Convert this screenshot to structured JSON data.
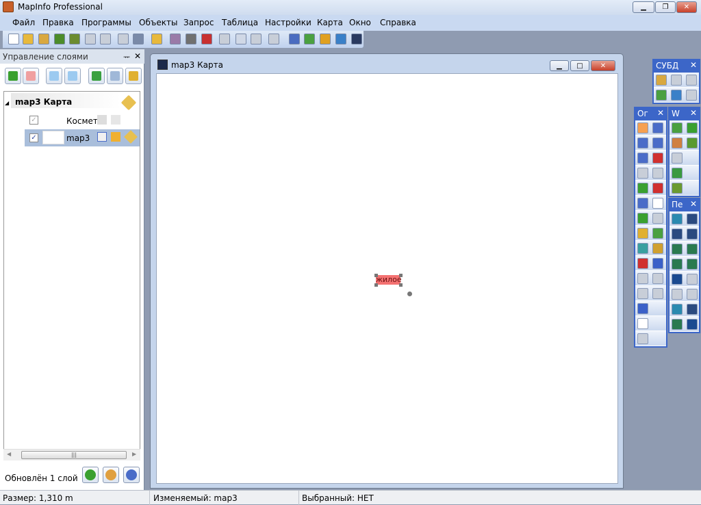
{
  "app": {
    "title": "MapInfo Professional",
    "window_controls": [
      "minimize",
      "restore",
      "close"
    ]
  },
  "menu": [
    "Файл",
    "Правка",
    "Программы",
    "Объекты",
    "Запрос",
    "Таблица",
    "Настройки",
    "Карта",
    "Окно",
    "Справка"
  ],
  "toolbar": [
    {
      "icon": "new-icon",
      "color": "#ffffff"
    },
    {
      "icon": "open-icon",
      "color": "#e8b93c"
    },
    {
      "icon": "open-workspace-icon",
      "color": "#d9a840"
    },
    {
      "icon": "open-dbms-icon",
      "color": "#4c8c2a"
    },
    {
      "icon": "open-universal-icon",
      "color": "#6c8c30"
    },
    {
      "icon": "disabled-icon",
      "color": "#c8ced8"
    },
    {
      "icon": "disabled-icon",
      "color": "#c8ced8"
    },
    {
      "icon": "save-icon",
      "color": "#c8ced8"
    },
    {
      "icon": "save-copy-icon",
      "color": "#7a8aa8"
    },
    {
      "icon": "open-folder-icon",
      "color": "#e8b93c"
    },
    {
      "icon": "save-workspace-icon",
      "color": "#9a7aa8"
    },
    {
      "icon": "print-icon",
      "color": "#707070"
    },
    {
      "icon": "print-pdf-icon",
      "color": "#c83030"
    },
    {
      "icon": "cut-icon",
      "color": "#c8ced8"
    },
    {
      "icon": "copy-icon",
      "color": "#d0d8e6"
    },
    {
      "icon": "paste-icon",
      "color": "#c8ced8"
    },
    {
      "icon": "undo-icon",
      "color": "#c8ced8"
    },
    {
      "icon": "new-browser-icon",
      "color": "#4a6cc0"
    },
    {
      "icon": "new-map-icon",
      "color": "#4aa040"
    },
    {
      "icon": "new-graph-icon",
      "color": "#e0a020"
    },
    {
      "icon": "new-layout-icon",
      "color": "#3a80c8"
    },
    {
      "icon": "new-redistrict-icon",
      "color": "#2a3a60"
    }
  ],
  "layer_panel": {
    "title": "Управление слоями",
    "pin": "ᅲ",
    "close": "✕",
    "buttons": [
      {
        "icon": "add-layer-icon",
        "color": "#3aa030"
      },
      {
        "icon": "remove-layer-icon",
        "color": "#f0a0a0"
      },
      {
        "icon": "move-up-icon",
        "color": "#9ccaf0"
      },
      {
        "icon": "move-down-icon",
        "color": "#9ccaf0"
      },
      {
        "icon": "layer-control-icon",
        "color": "#3aa040"
      },
      {
        "icon": "layer-options-icon",
        "color": "#a0b8d8"
      },
      {
        "icon": "label-options-icon",
        "color": "#e0b030"
      }
    ],
    "root": "map3 Карта",
    "layers": [
      {
        "name": "Космет",
        "checked": true,
        "enabled": false
      },
      {
        "name": "map3",
        "checked": true,
        "enabled": true,
        "selected": true
      }
    ],
    "status": "Обновлён 1 слой",
    "footer_buttons": [
      {
        "icon": "power-icon",
        "color": "#3aa030"
      },
      {
        "icon": "layer-list-icon",
        "color": "#e0a040"
      },
      {
        "icon": "help-icon",
        "color": "#4a6cc8"
      }
    ]
  },
  "map_window": {
    "title": "map3 Карта",
    "label": "жилое"
  },
  "status_bar": {
    "size": "Размер: 1,310 m",
    "editable": "Изменяемый: map3",
    "selected": "Выбранный: НЕТ"
  },
  "palettes": {
    "dbms": {
      "title": "СУБД",
      "rows": [
        [
          "#d8a840",
          "#c8ced8",
          "#c8ced8"
        ],
        [
          "#4aa040",
          "#3a80c8",
          "#c8ced8"
        ]
      ]
    },
    "main": {
      "title": "Ог",
      "rows": [
        [
          "#f6a050",
          "#4a6cc8"
        ],
        [
          "#4a6cc8",
          "#4a6cc8"
        ],
        [
          "#4a6cc8",
          "#d03030"
        ],
        [
          "#c8ced8",
          "#c8ced8"
        ],
        [
          "#3aa030",
          "#d03030"
        ],
        [
          "#4a6cc8",
          "#ffffff"
        ],
        [
          "#3aa030",
          "#c8ced8"
        ],
        [
          "#e0b030",
          "#4aa040"
        ],
        [
          "#3aa0a0",
          "#d0a030"
        ],
        [
          "#d03030",
          "#3a60c8"
        ],
        [
          "#c8ced8",
          "#c8ced8"
        ],
        [
          "#c8ced8",
          "#c8ced8"
        ],
        [
          "#3a60c8"
        ],
        [
          "#ffffff"
        ],
        [
          "#c8ced8"
        ]
      ]
    },
    "web": {
      "title": "W",
      "rows": [
        [
          "#4aa040",
          "#3aa030"
        ],
        [
          "#d08040",
          "#5a9a30"
        ],
        [
          "#c8ced8"
        ],
        [
          "#3a9a40"
        ],
        [
          "#6a9a30"
        ]
      ]
    },
    "drawing": {
      "title": "Пе",
      "rows": [
        [
          "#2a8ab0",
          "#2a4a80"
        ],
        [
          "#2a4a80",
          "#2a4a80"
        ],
        [
          "#2a7a50",
          "#2a7a50"
        ],
        [
          "#2a7a50",
          "#2a7a50"
        ],
        [
          "#1a4a90",
          "#c8ced8"
        ],
        [
          "#c8ced8",
          "#c8ced8"
        ],
        [
          "#2a8ab0",
          "#2a4a80"
        ],
        [
          "#2a7a50",
          "#1a4a90"
        ]
      ]
    }
  }
}
